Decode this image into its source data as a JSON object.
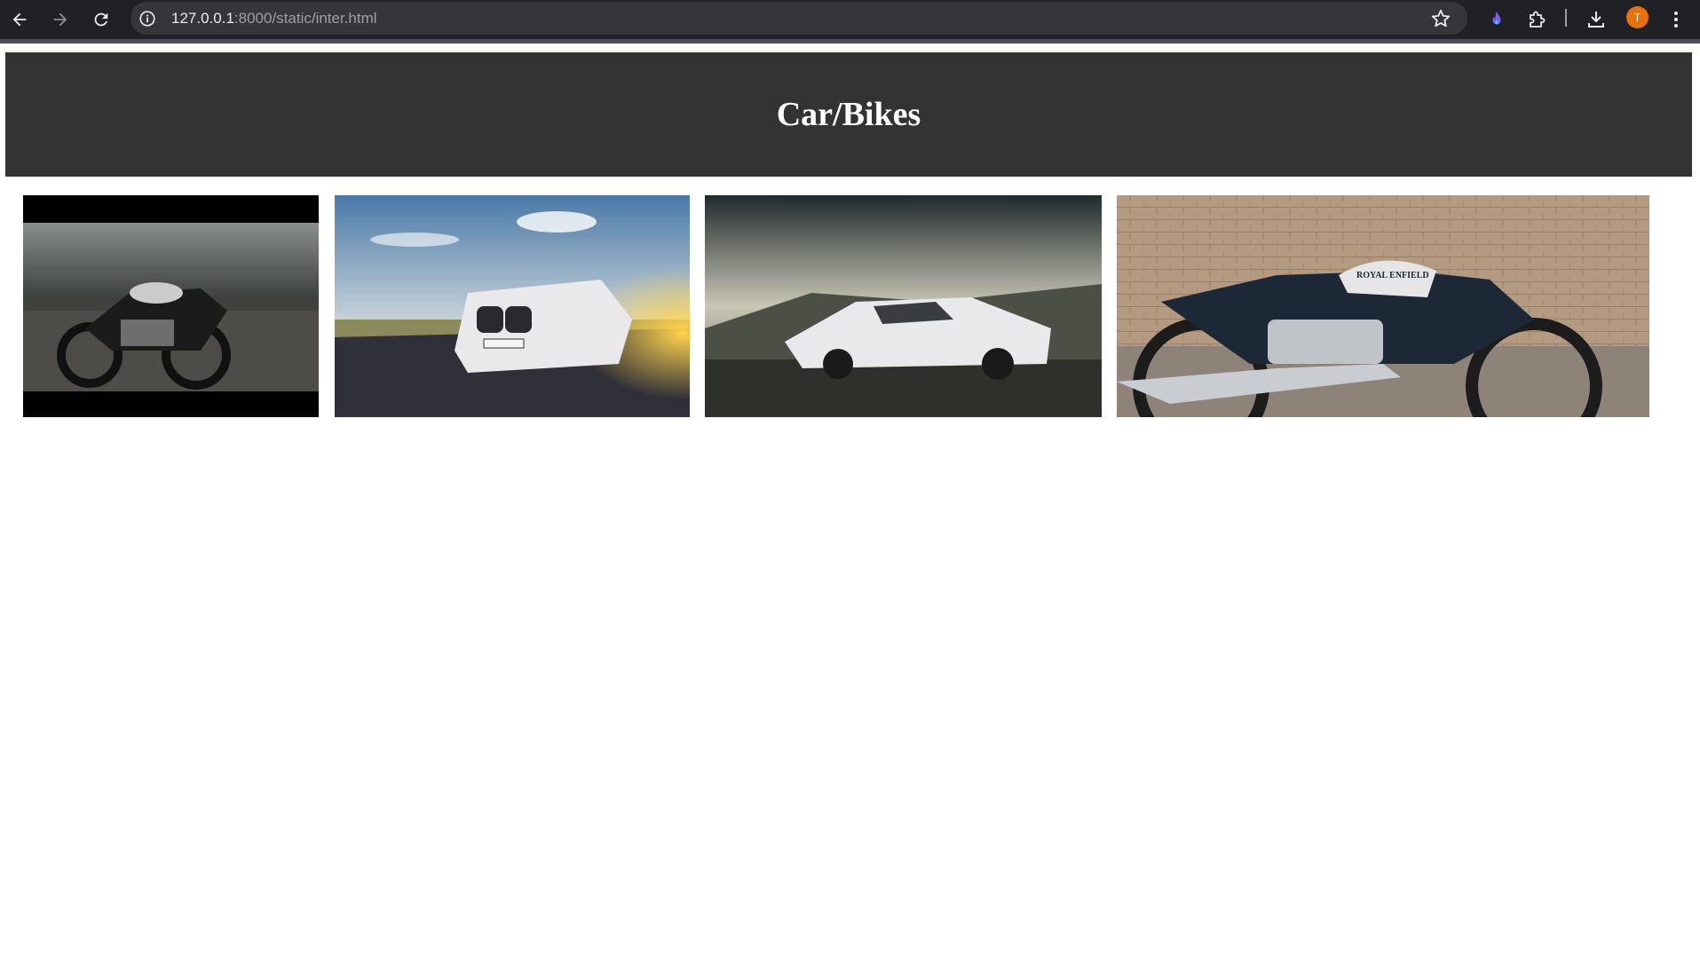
{
  "browser": {
    "url_host": "127.0.0.1",
    "url_path": ":8000/static/inter.html",
    "profile_initial": "T",
    "icons": [
      "back-arrow-icon",
      "forward-arrow-icon",
      "reload-icon",
      "info-icon",
      "star-icon",
      "flame-extension-icon",
      "puzzle-extension-icon",
      "download-icon",
      "kebab-menu-icon"
    ]
  },
  "page": {
    "title": "Car/Bikes",
    "images": [
      {
        "subject": "motorcycle"
      },
      {
        "subject": "car"
      },
      {
        "subject": "car"
      },
      {
        "subject": "motorcycle",
        "logo_text": "ROYAL ENFIELD"
      }
    ]
  },
  "colors": {
    "header_bg": "#333333",
    "header_text": "#ffffff",
    "chrome_bg": "#202124",
    "avatar": "#e8710a"
  }
}
